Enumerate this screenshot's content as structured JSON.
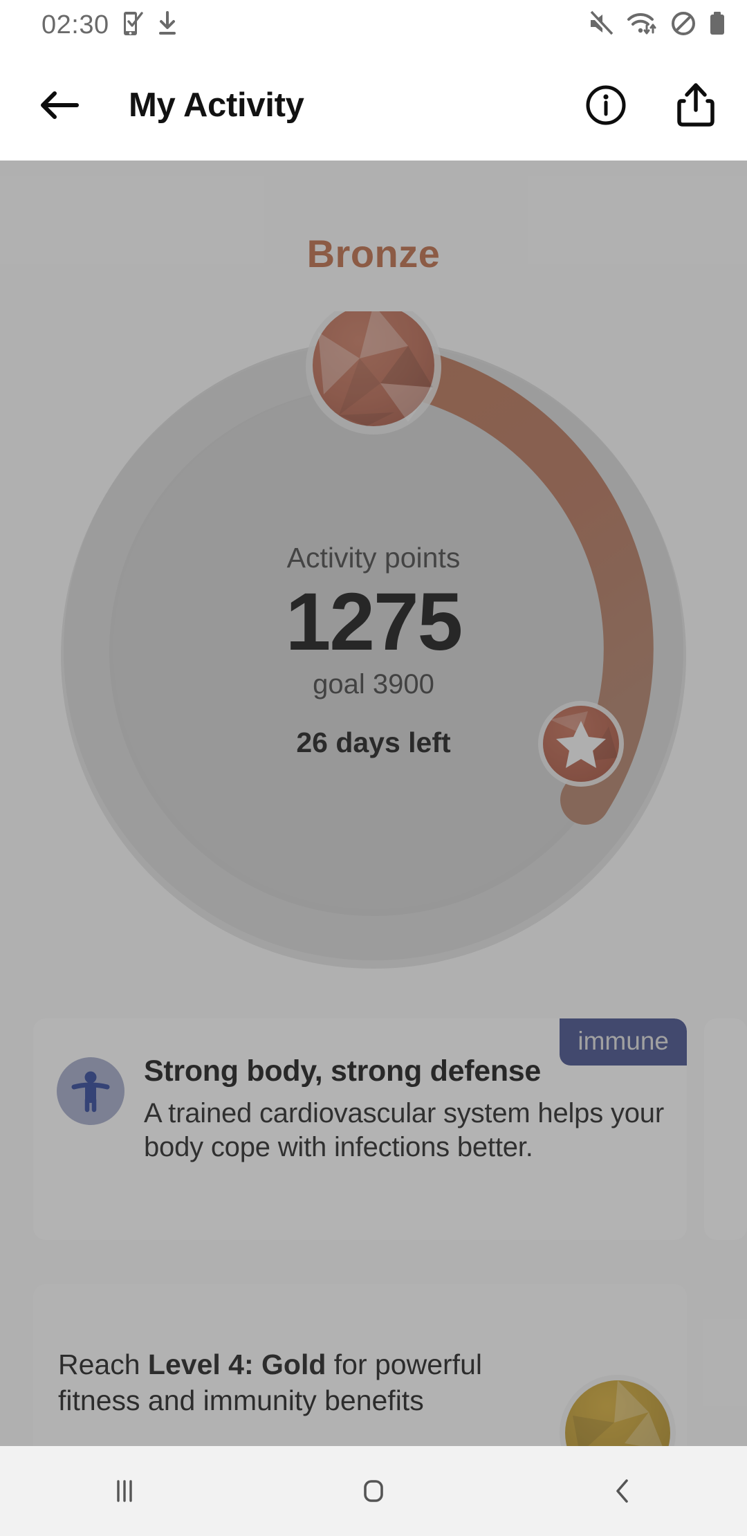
{
  "status_bar": {
    "time": "02:30",
    "icons": [
      "phone-check-icon",
      "download-icon",
      "mute-icon",
      "wifi-icon",
      "do-not-disturb-icon",
      "battery-icon"
    ]
  },
  "app_bar": {
    "back_label": "back-arrow",
    "title": "My Activity",
    "info_label": "info",
    "share_label": "share"
  },
  "activity": {
    "level_name": "Bronze",
    "points_label": "Activity points",
    "points_value": "1275",
    "goal_label": "goal 3900",
    "days_left": "26 days left",
    "gem_icon": "bronze-gem-icon",
    "milestone_icon": "star-badge-icon"
  },
  "gauge": {
    "current": 1275,
    "goal": 3900,
    "percent": 32.7,
    "track_color": "#c9c9c9",
    "progress_color": "#b06a4c",
    "milestone_percent": 27.0
  },
  "benefit_card": {
    "badge": "immune",
    "icon": "accessibility-person-icon",
    "title": "Strong body, strong defense",
    "description": "A trained cardiovascular system helps your body cope with infections better."
  },
  "level_card": {
    "text_prefix": "Reach ",
    "text_bold": "Level 4: Gold",
    "text_suffix": " for powerful",
    "text_line2": "fitness and immunity benefits",
    "gem_icon": "gold-gem-icon"
  },
  "nav_bar": {
    "recents_label": "recents",
    "home_label": "home",
    "back_label": "back"
  },
  "colors": {
    "bronze": "#b4633f",
    "progress": "#b06a4c",
    "badge_blue": "#3a4582",
    "accent_icon_blue": "#243b8f"
  }
}
